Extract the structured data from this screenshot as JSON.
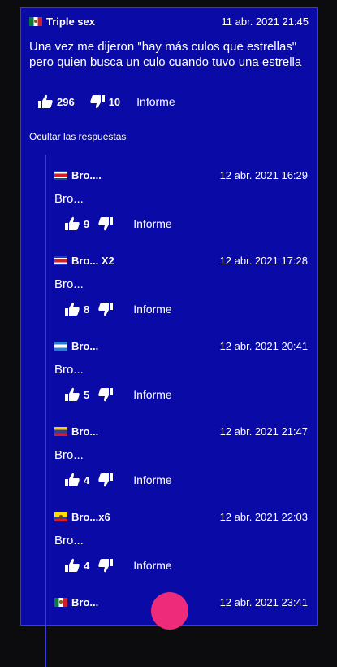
{
  "post": {
    "author": "Triple sex",
    "date": "11 abr. 2021 21:45",
    "text": "Una vez me dijeron \"hay más culos que estrellas\" pero quien busca un culo cuando tuvo una estrella",
    "likes": "296",
    "dislikes": "10",
    "report": "Informe"
  },
  "toggle_label": "Ocultar las respuestas",
  "replies": [
    {
      "author": "Bro....",
      "date": "12 abr. 2021 16:29",
      "text": "Bro...",
      "likes": "9",
      "report": "Informe"
    },
    {
      "author": "Bro... X2",
      "date": "12 abr. 2021 17:28",
      "text": "Bro...",
      "likes": "8",
      "report": "Informe"
    },
    {
      "author": "Bro...",
      "date": "12 abr. 2021 20:41",
      "text": "Bro...",
      "likes": "5",
      "report": "Informe"
    },
    {
      "author": "Bro...",
      "date": "12 abr. 2021 21:47",
      "text": "Bro...",
      "likes": "4",
      "report": "Informe"
    },
    {
      "author": "Bro...x6",
      "date": "12 abr. 2021 22:03",
      "text": "Bro...",
      "likes": "4",
      "report": "Informe"
    },
    {
      "author": "Bro...",
      "date": "12 abr. 2021 23:41",
      "text": "",
      "likes": "",
      "report": ""
    }
  ],
  "icons": {
    "like": "thumbs-up-icon",
    "dislike": "thumbs-down-icon"
  },
  "colors": {
    "background": "#0a0aa6",
    "border": "#3a3ad8",
    "accent_fab": "#ee2a7b"
  }
}
